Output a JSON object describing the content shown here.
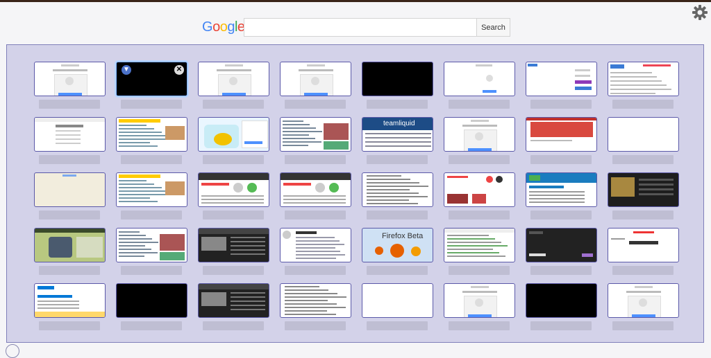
{
  "logo": {
    "text": "Google"
  },
  "search": {
    "placeholder": "",
    "button_label": "Search"
  },
  "icons": {
    "settings": "gear-icon",
    "pin": "pin-icon",
    "close": "close-icon"
  },
  "tiles": [
    {
      "style": "google-signin",
      "pinned": false
    },
    {
      "style": "black",
      "pinned": true,
      "close": true
    },
    {
      "style": "google-signin",
      "pinned": false
    },
    {
      "style": "google-signin",
      "pinned": false
    },
    {
      "style": "black",
      "pinned": false
    },
    {
      "style": "signin-right",
      "pinned": false
    },
    {
      "style": "login-form",
      "pinned": false
    },
    {
      "style": "dense-page",
      "pinned": false
    },
    {
      "style": "form-page",
      "pinned": false
    },
    {
      "style": "news-page",
      "pinned": false
    },
    {
      "style": "cartoon",
      "pinned": false
    },
    {
      "style": "news-images",
      "pinned": false
    },
    {
      "style": "teamliquid",
      "pinned": false,
      "text": "teamliquid"
    },
    {
      "style": "google-signin",
      "pinned": false
    },
    {
      "style": "red-header",
      "pinned": false
    },
    {
      "style": "blank",
      "pinned": false
    },
    {
      "style": "beige",
      "pinned": false
    },
    {
      "style": "news-page",
      "pinned": false
    },
    {
      "style": "dark-header",
      "pinned": false
    },
    {
      "style": "dark-header",
      "pinned": false
    },
    {
      "style": "text-list",
      "pinned": false
    },
    {
      "style": "profile",
      "pinned": false
    },
    {
      "style": "blue-portal",
      "pinned": false
    },
    {
      "style": "dark-media",
      "pinned": false
    },
    {
      "style": "gaming",
      "pinned": false
    },
    {
      "style": "news-images",
      "pinned": false
    },
    {
      "style": "dark-site",
      "pinned": false
    },
    {
      "style": "wiki",
      "pinned": false
    },
    {
      "style": "firefox",
      "pinned": false,
      "text": "Firefox Beta"
    },
    {
      "style": "code-review",
      "pinned": false
    },
    {
      "style": "dark-panel",
      "pinned": false
    },
    {
      "style": "centered-text",
      "pinned": false
    },
    {
      "style": "ms-page",
      "pinned": false
    },
    {
      "style": "black",
      "pinned": false
    },
    {
      "style": "dark-site",
      "pinned": false
    },
    {
      "style": "text-list",
      "pinned": false
    },
    {
      "style": "empty",
      "pinned": false
    },
    {
      "style": "google-signin",
      "pinned": false
    },
    {
      "style": "black",
      "pinned": false
    },
    {
      "style": "google-signin",
      "pinned": false
    }
  ],
  "colors": {
    "panel_bg": "#d3d2e9",
    "tile_border": "#5a58a8",
    "label_placeholder": "#bfbed3",
    "teamliquid_blue": "#1d4c86",
    "firefox_bg": "#cfe1f4"
  }
}
